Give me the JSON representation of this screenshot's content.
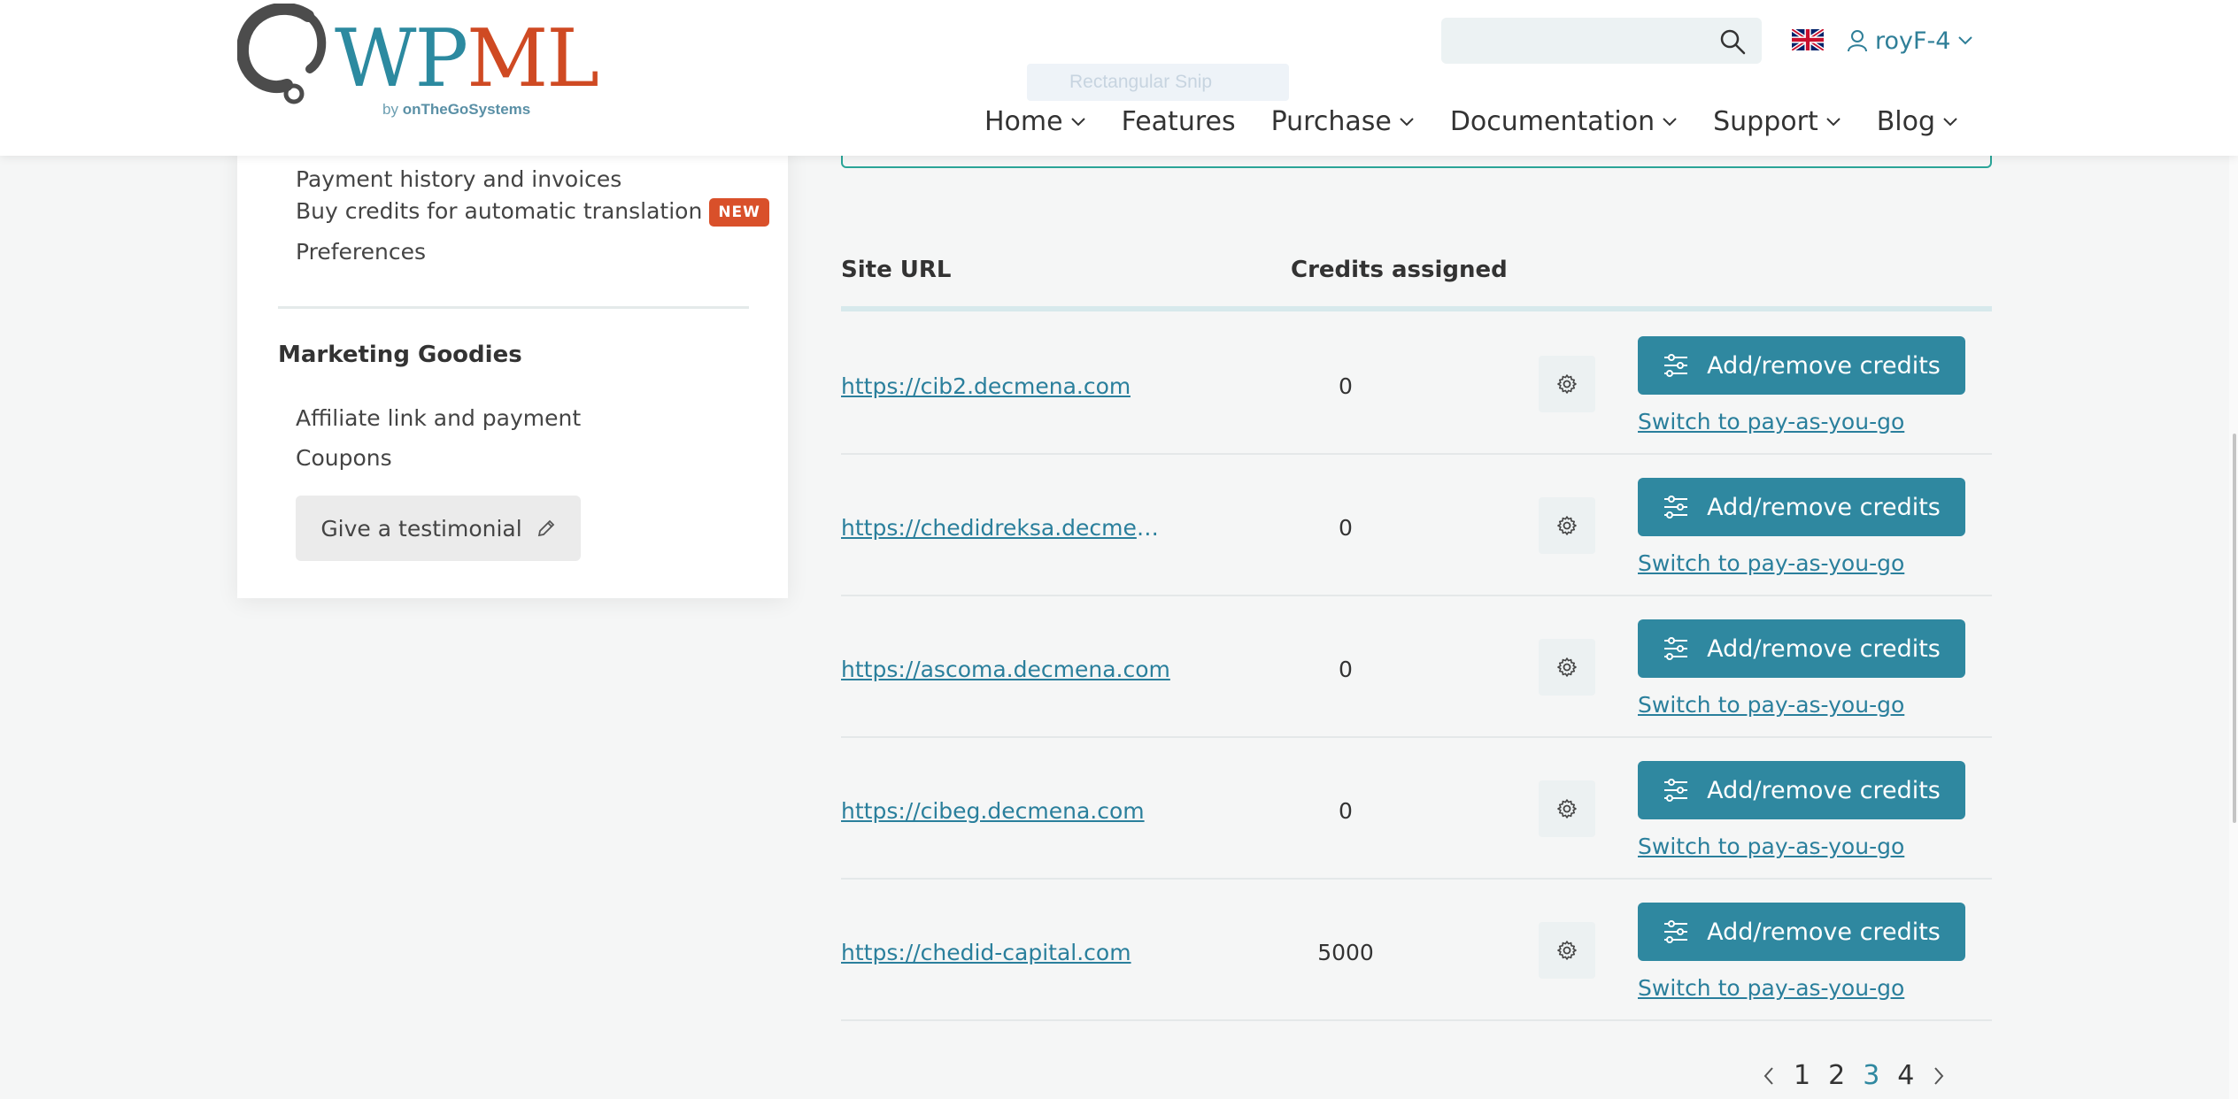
{
  "header": {
    "logo": {
      "part1": "WP",
      "part2": "ML",
      "by": "by",
      "company": "onTheGoSystems"
    },
    "snip_ghost": "Rectangular Snip",
    "search": {
      "value": "",
      "placeholder": ""
    },
    "language": "en-GB",
    "user": "royF-4",
    "nav": [
      "Home",
      "Features",
      "Purchase",
      "Documentation",
      "Support",
      "Blog"
    ]
  },
  "sidebar": {
    "links": [
      "Payment history and invoices",
      "Buy credits for automatic translation",
      "Preferences"
    ],
    "new_badge": "NEW",
    "marketing_heading": "Marketing Goodies",
    "marketing_links": [
      "Affiliate link and payment",
      "Coupons"
    ],
    "testimonial_button": "Give a testimonial"
  },
  "table": {
    "col_site": "Site URL",
    "col_credits": "Credits assigned",
    "add_label": "Add/remove credits",
    "switch_label": "Switch to pay-as-you-go",
    "rows": [
      {
        "url": "https://cib2.decmena.com",
        "credits": "0"
      },
      {
        "url": "https://chedidreksa.decmena.com",
        "credits": "0"
      },
      {
        "url": "https://ascoma.decmena.com",
        "credits": "0"
      },
      {
        "url": "https://cibeg.decmena.com",
        "credits": "0"
      },
      {
        "url": "https://chedid-capital.com",
        "credits": "5000"
      }
    ]
  },
  "pagination": {
    "pages": [
      "1",
      "2",
      "3",
      "4"
    ],
    "current": "3"
  },
  "colors": {
    "accent": "#2f88a0",
    "brand_red": "#cf4a23",
    "badge": "#d9502a",
    "frame_green": "#2aa598"
  }
}
